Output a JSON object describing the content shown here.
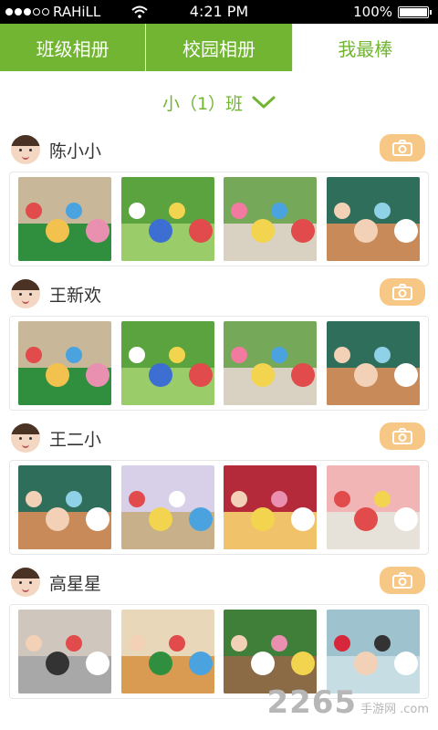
{
  "statusbar": {
    "carrier": "RAHiLL",
    "time": "4:21 PM",
    "battery": "100%",
    "battery_level": 1.0,
    "signal_bars_on": 3,
    "signal_bars_total": 5
  },
  "tabs": [
    {
      "label": "班级相册",
      "active": false
    },
    {
      "label": "校园相册",
      "active": false
    },
    {
      "label": "我最棒",
      "active": true
    }
  ],
  "class_selector": {
    "label": "小（1）班",
    "icon": "chevron-down-icon"
  },
  "students": [
    {
      "name": "陈小小",
      "camera_icon": "camera-icon",
      "photos": [
        "classroom-table",
        "playground-children",
        "maypole-dance",
        "two-kids-closeup"
      ]
    },
    {
      "name": "王新欢",
      "camera_icon": "camera-icon",
      "photos": [
        "classroom-table",
        "playground-children",
        "maypole-dance",
        "two-kids-closeup"
      ]
    },
    {
      "name": "王二小",
      "camera_icon": "camera-icon",
      "photos": [
        "two-kids-closeup",
        "party-table",
        "girl-smiling",
        "stage-performance"
      ]
    },
    {
      "name": "高星星",
      "camera_icon": "camera-icon",
      "photos": [
        "child-in-chair",
        "kids-playing",
        "garden-digging",
        "girl-red-jacket"
      ]
    }
  ],
  "watermark": {
    "logo_text": "2265",
    "site_text": "手游网",
    "domain_text": ".com"
  },
  "colors": {
    "accent": "#71b533",
    "camera_button": "#f7c785",
    "statusbar": "#000000"
  }
}
